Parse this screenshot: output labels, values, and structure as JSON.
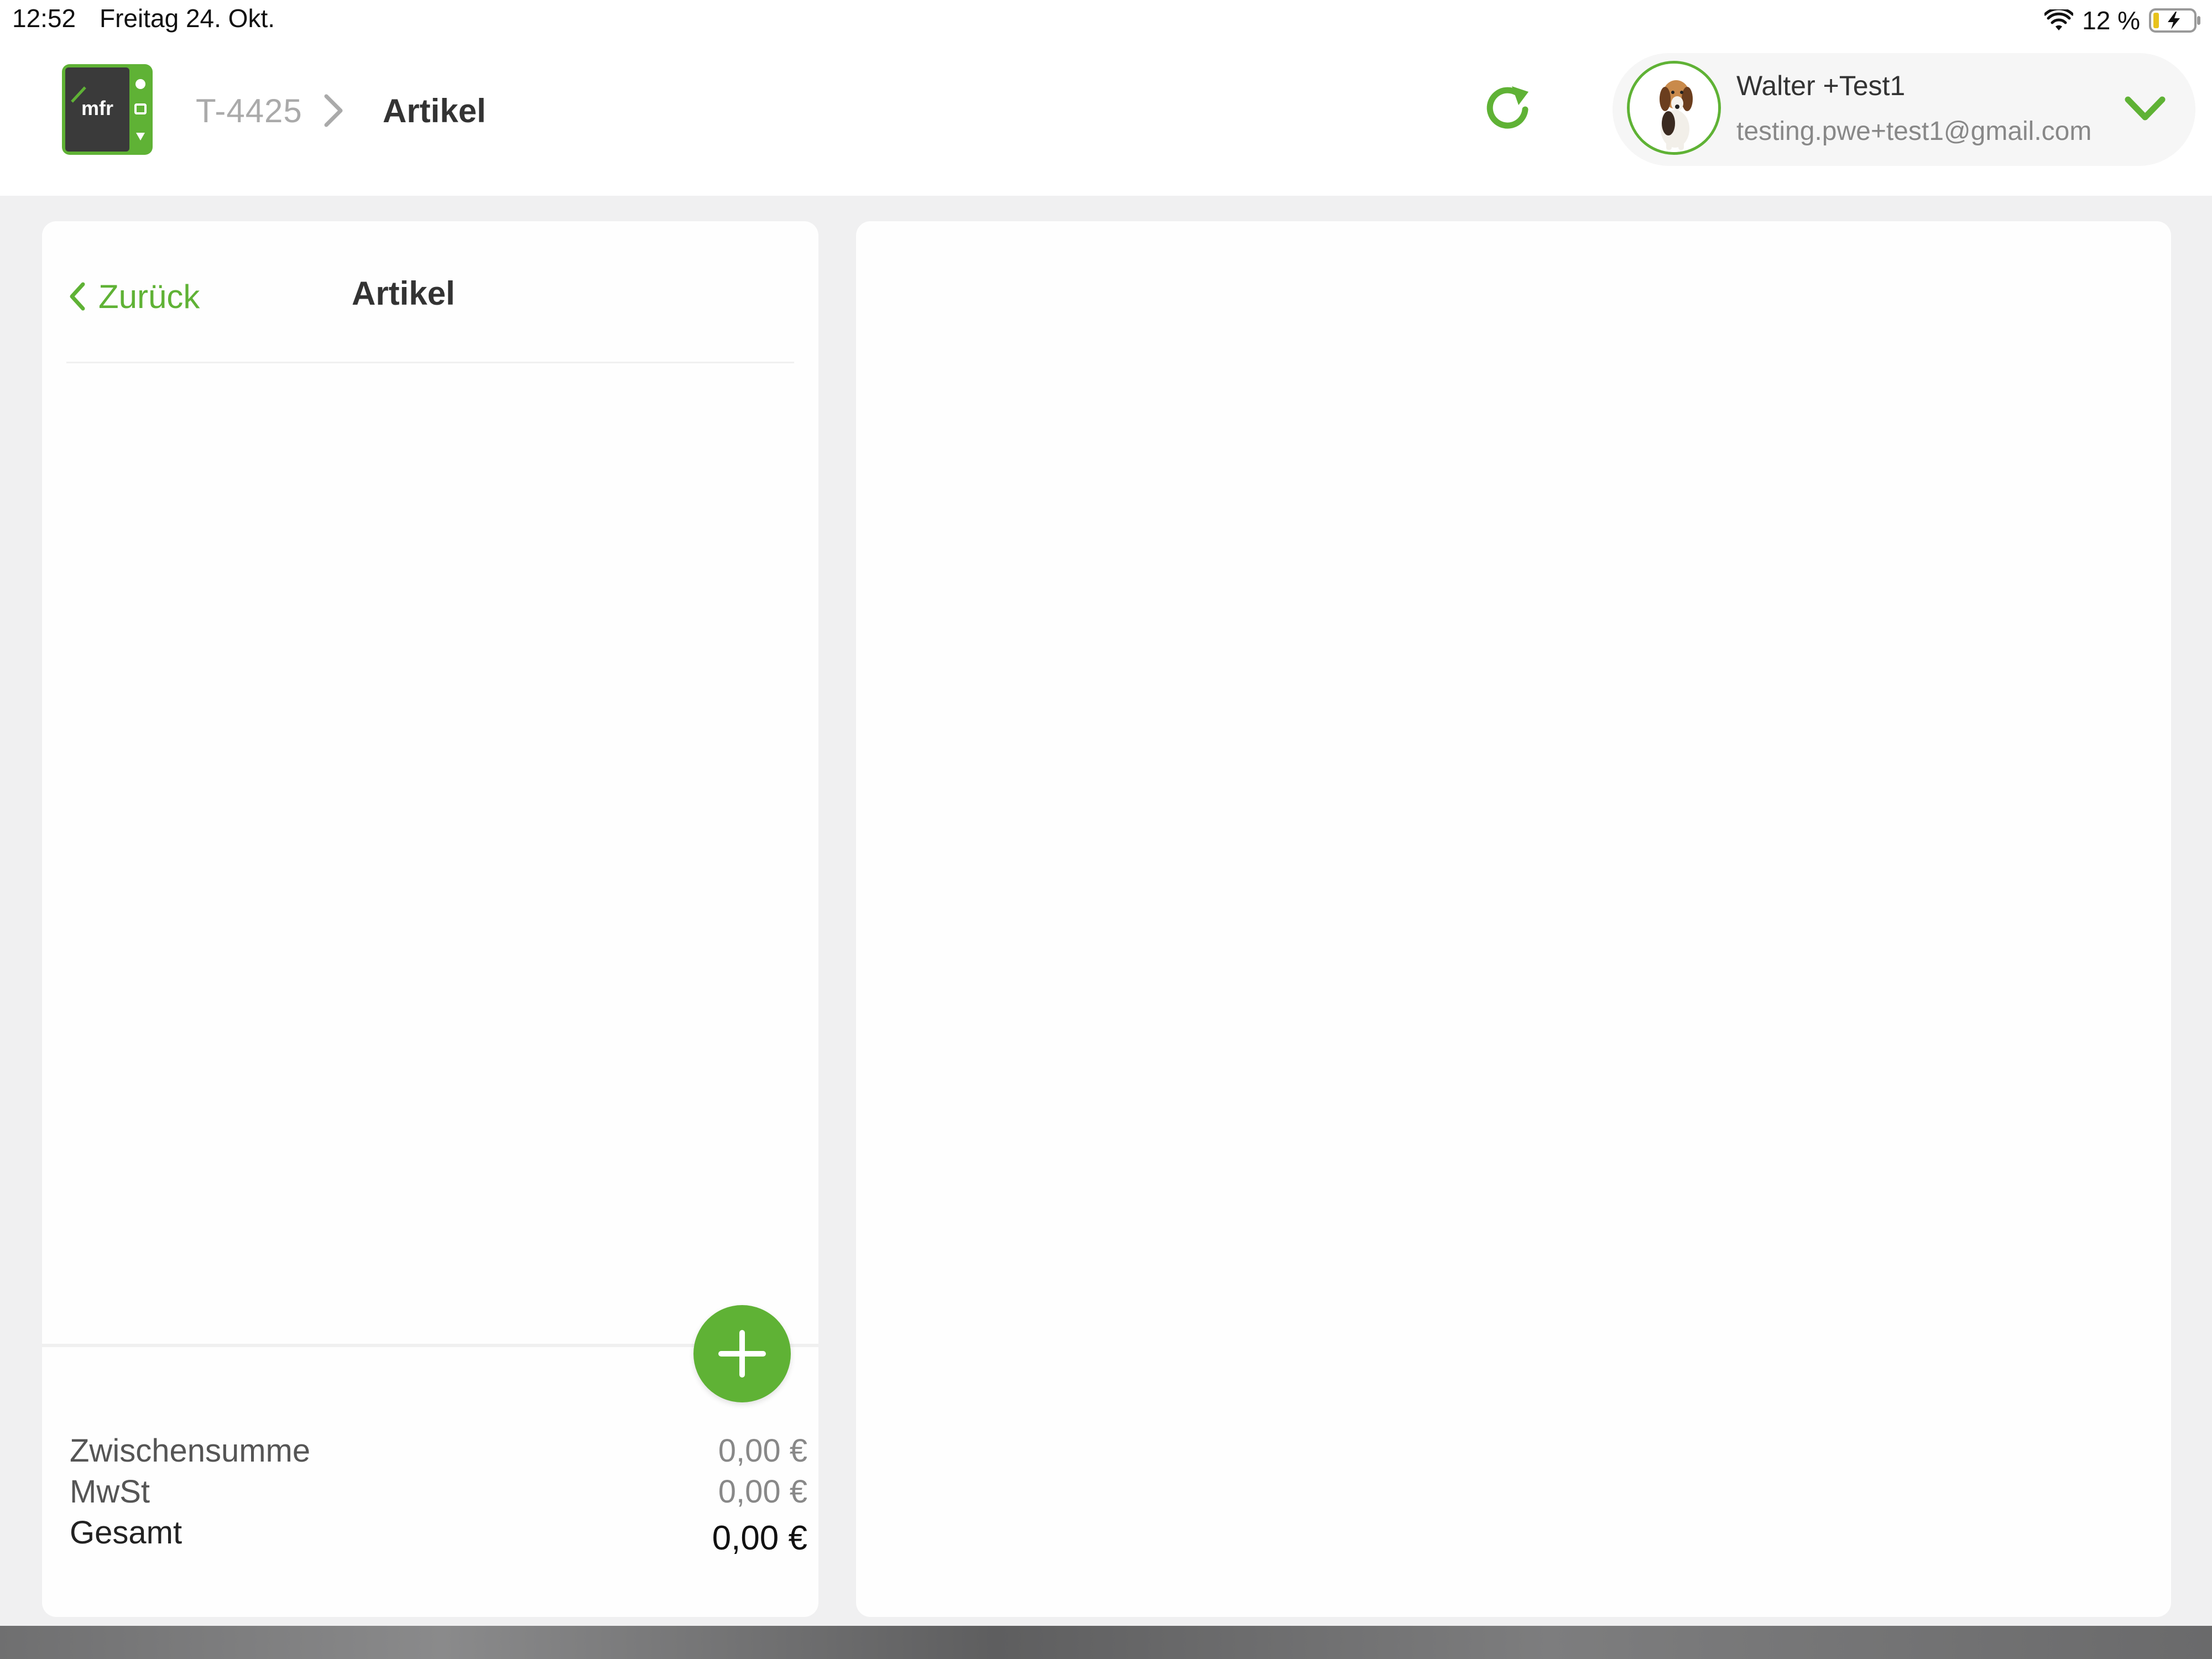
{
  "status_bar": {
    "time": "12:52",
    "date": "Freitag 24. Okt.",
    "battery_percent": "12 %",
    "icons": [
      "wifi-icon",
      "battery-charging-icon"
    ]
  },
  "header": {
    "logo_text": "mfr",
    "breadcrumb": {
      "parent": "T-4425",
      "current": "Artikel"
    },
    "refresh_icon": "refresh-icon",
    "user": {
      "name": "Walter +Test1",
      "email": "testing.pwe+test1@gmail.com",
      "dropdown_icon": "chevron-down-icon"
    }
  },
  "left_panel": {
    "back_label": "Zurück",
    "title": "Artikel",
    "add_icon": "plus-icon",
    "totals": {
      "subtotal_label": "Zwischensumme",
      "subtotal_value": "0,00 €",
      "tax_label": "MwSt",
      "tax_value": "0,00 €",
      "total_label": "Gesamt",
      "total_value": "0,00 €"
    }
  },
  "colors": {
    "accent": "#5fb235",
    "background": "#f0f0f1",
    "panel": "#fefefe"
  }
}
